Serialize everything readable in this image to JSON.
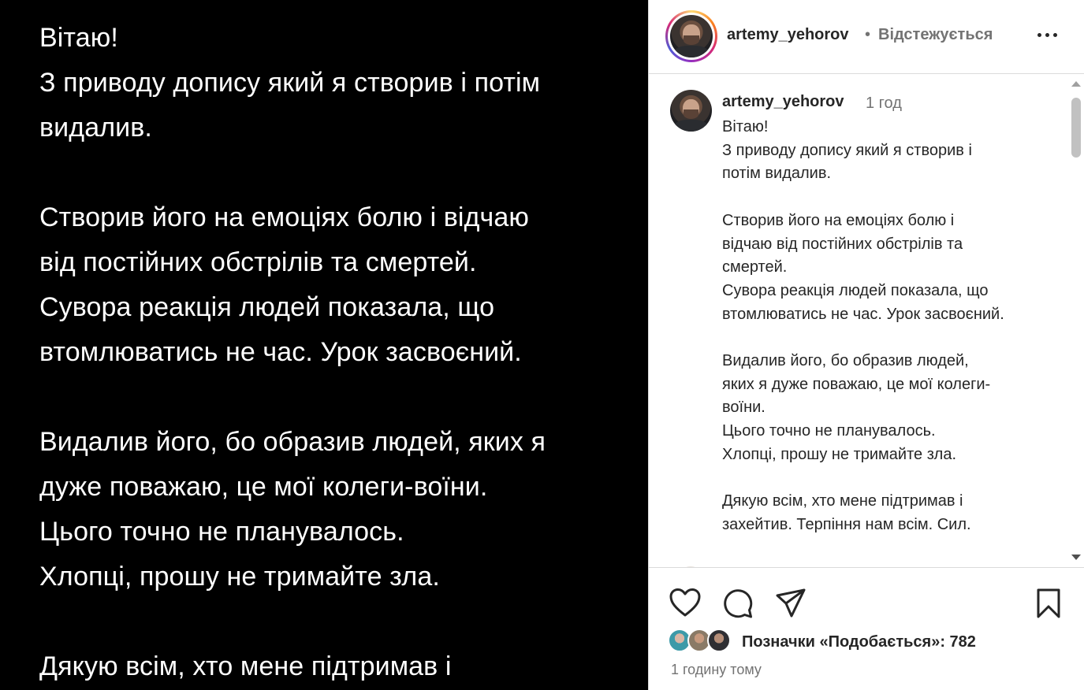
{
  "media": {
    "text": "Вітаю!\nЗ приводу допису який я створив і потім\nвидалив.\n\nСтворив його на емоціях болю і відчаю\nвід постійних обстрілів та смертей.\nСувора реакція людей показала, що\nвтомлюватись не час. Урок засвоєний.\n\nВидалив його, бо образив людей, яких я\nдуже поважаю, це мої колеги-воїни.\nЦього точно не планувалось.\nХлопці, прошу не тримайте зла.\n\nДякую всім, хто мене підтримав і"
  },
  "header": {
    "username": "artemy_yehorov",
    "separator": "•",
    "follow_status": "Відстежується",
    "more_icon": "more-horizontal-icon"
  },
  "caption": {
    "username": "artemy_yehorov",
    "time": "1 год",
    "text": "Вітаю!\nЗ приводу допису який я створив і\nпотім видалив.\n\nСтворив його на емоціях болю і\nвідчаю від постійних обстрілів та\nсмертей.\nСувора реакція людей показала, що\nвтомлюватись не час. Урок засвоєний.\n\nВидалив його, бо образив людей,\nяких я дуже поважаю, це мої колеги-\nвоїни.\nЦього точно не планувалось.\nХлопці, прошу не тримайте зла.\n\nДякую всім, хто мене підтримав і\nзахейтив. Терпіння нам всім. Сил."
  },
  "actions": {
    "like_icon": "heart-icon",
    "comment_icon": "comment-icon",
    "share_icon": "send-icon",
    "save_icon": "bookmark-icon"
  },
  "likes": {
    "label": "Позначки «Подобається»: 782"
  },
  "posted": {
    "time": "1 годину тому"
  },
  "colors": {
    "text_primary": "#262626",
    "text_secondary": "#737373",
    "border": "#dbdbdb",
    "media_background": "#000000"
  }
}
